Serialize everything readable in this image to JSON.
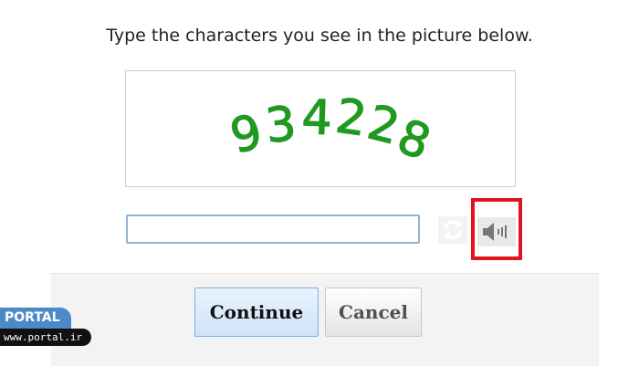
{
  "instruction": "Type the characters you see in the picture below.",
  "captcha": {
    "characters": "934228",
    "char_color": "#1f9a1f"
  },
  "answer_input": {
    "value": "",
    "placeholder": ""
  },
  "icons": {
    "refresh": "refresh-icon",
    "audio": "speaker-icon"
  },
  "buttons": {
    "continue": "Continue",
    "cancel": "Cancel"
  },
  "watermark": {
    "brand": "PORTAL",
    "site": "www.portal.ir"
  },
  "colors": {
    "highlight": "#e0141e",
    "watermark_brand_bg": "#4c89c7"
  }
}
